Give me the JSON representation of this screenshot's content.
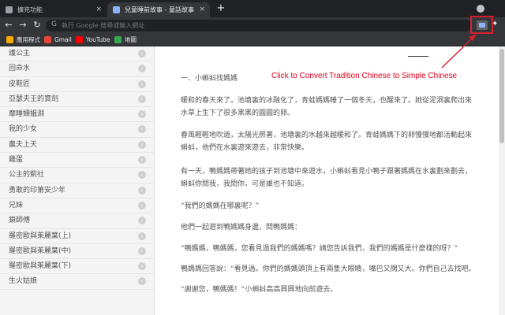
{
  "tabs": [
    {
      "title": "擴充功能",
      "close": "×"
    },
    {
      "title": "兒童睡前故事 - 童話故事",
      "close": "×"
    }
  ],
  "new_tab": "+",
  "toolbar": {
    "back": "←",
    "forward": "→",
    "reload": "↻",
    "search_glyph": "G",
    "omnibox_placeholder": "執行 Google 搜尋或輸入網址",
    "puzzle": "✦"
  },
  "bookmarks": [
    {
      "label": "應用程式",
      "color": "#f9ab00"
    },
    {
      "label": "Gmail",
      "color": "#ea4335"
    },
    {
      "label": "YouTube",
      "color": "#ff0000"
    },
    {
      "label": "地圖",
      "color": "#34a853"
    }
  ],
  "sidebar": {
    "chevron": "›",
    "items": [
      "護公主",
      "回命水",
      "皮鞋匠",
      "亞瑟夫王的寶劍",
      "靡睡姍娥淵",
      "我的少女",
      "農夫上天",
      "雞蛋",
      "公主的薊社",
      "勇敢的印第安少年",
      "兄妹",
      "鎖師傅",
      "羅密歐與茱麗葉(上)",
      "羅密歐與茱麗葉(中)",
      "羅密歐與茱麗葉(下)",
      "生火姑娘"
    ]
  },
  "story": {
    "dash": "——",
    "heading": "一、小蝌蚪找媽媽",
    "paragraphs": [
      "暖和的春天來了。池塘裏的冰融化了，青蛙媽媽睡了一個冬天，也醒來了。她從泥洞裏爬出來",
      "水草上生下了很多黑黑的圓圓的卵。",
      "春風輕輕地吹過，太陽光照著，池塘裏的水越來越暖和了。青蛙媽媽下的卵慢慢地都活動起來",
      "蝌蚪，他們在水裏遊來遊去，非常快樂。",
      "有一天，鴨媽媽帶著她的孩子到池塘中來遊水，小蝌蚪看見小鴨子跟著媽媽在水裏劃來劃去，",
      "蝌蚪你問我，我問你，可是誰也不知道。",
      "“我們的媽媽在哪裏呢？”",
      "他們一起遊到鴨媽媽身邊，問鴨媽媽：",
      "“鴨媽媽，鴨媽媽，您看見過我們的媽媽嗎？請您告訴我們，我們的媽媽是什麼樣的呀？”",
      "鴨媽媽回答說：“看見過。你們的媽媽頭頂上有兩隻大眼睛，嘴巴又闊又大。你們自己去找吧。",
      "“謝謝您，鴨媽媽！”小蝌蚪高高興興地向前遊去。"
    ]
  },
  "annotation": {
    "text": "Click to Convert Tradition Chinese to Simple Chinese",
    "color": "#e4001b"
  }
}
